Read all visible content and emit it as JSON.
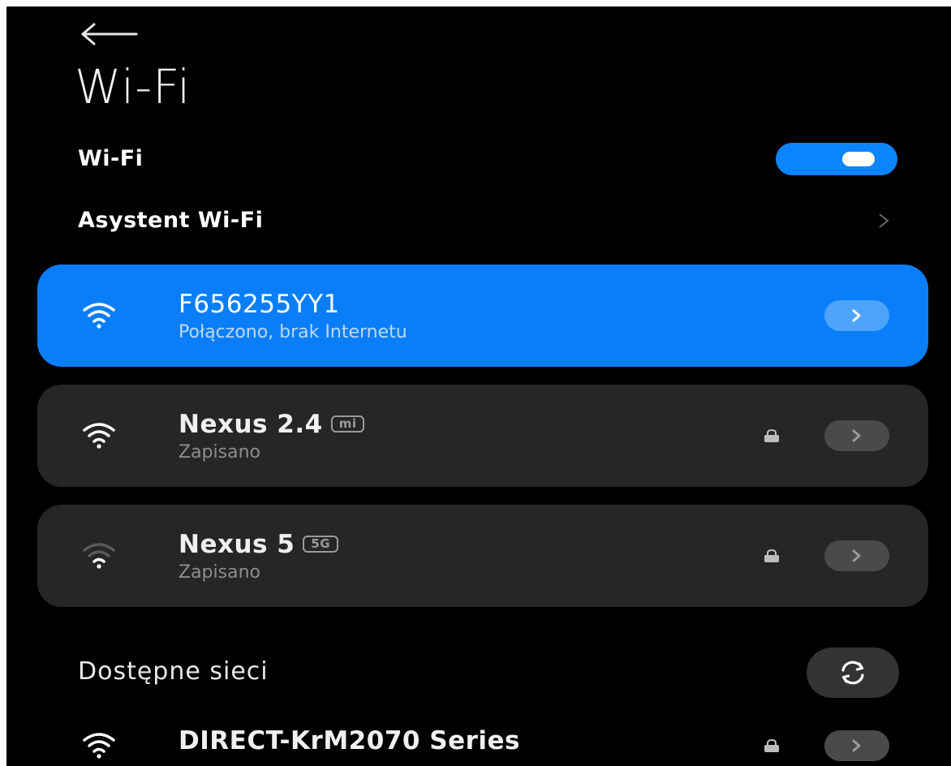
{
  "page": {
    "title": "Wi-Fi"
  },
  "settings": {
    "wifi_label": "Wi-Fi",
    "wifi_enabled": true,
    "assistant_label": "Asystent Wi-Fi"
  },
  "saved_networks": [
    {
      "name": "F656255YY1",
      "status": "Połączono, brak Internetu",
      "connected": true,
      "icon": "wifi-full-icon"
    },
    {
      "name": "Nexus 2.4",
      "badge": "mi",
      "status": "Zapisano",
      "secured": true,
      "icon": "wifi-full-icon"
    },
    {
      "name": "Nexus 5",
      "badge": "5G",
      "status": "Zapisano",
      "secured": true,
      "icon": "wifi-weak-icon"
    }
  ],
  "available": {
    "section_title": "Dostępne sieci",
    "networks": [
      {
        "name": "DIRECT-KrM2070 Series",
        "secured": true,
        "icon": "wifi-full-icon"
      }
    ]
  },
  "colors": {
    "background": "#000000",
    "accent": "#0a7ef8",
    "card": "#262626",
    "secondary_text": "#8d8d8d"
  }
}
